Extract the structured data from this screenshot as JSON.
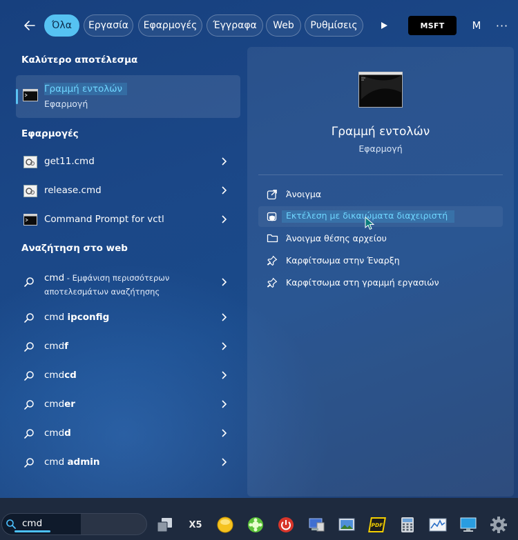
{
  "filters": {
    "tabs": [
      {
        "label": "Όλα",
        "active": true
      },
      {
        "label": "Εργασία"
      },
      {
        "label": "Εφαρμογές"
      },
      {
        "label": "Έγγραφα"
      },
      {
        "label": "Web"
      },
      {
        "label": "Ρυθμίσεις"
      }
    ],
    "msft_label": "MSFT",
    "avatar_initial": "M",
    "more_label": "···"
  },
  "best_match": {
    "section_title": "Καλύτερο αποτέλεσμα",
    "name": "Γραμμή εντολών",
    "type": "Εφαρμογή"
  },
  "apps": {
    "section_title": "Εφαρμογές",
    "items": [
      {
        "label": "get11.cmd",
        "icon": "script-file-icon"
      },
      {
        "label": "release.cmd",
        "icon": "script-file-icon"
      },
      {
        "label": "Command Prompt for vctl",
        "icon": "terminal-icon"
      }
    ]
  },
  "web": {
    "section_title": "Αναζήτηση στο web",
    "first": {
      "query": "cmd",
      "hint_line1": " - Εμφάνιση περισσότερων",
      "hint_line2": "αποτελεσμάτων αναζήτησης"
    },
    "items": [
      {
        "prefix": "cmd ",
        "bold": "ipconfig"
      },
      {
        "prefix": "cmd",
        "bold": "f"
      },
      {
        "prefix": "cmd",
        "bold": "cd"
      },
      {
        "prefix": "cmd",
        "bold": "er"
      },
      {
        "prefix": "cmd",
        "bold": "d"
      },
      {
        "prefix": "cmd ",
        "bold": "admin"
      }
    ]
  },
  "preview": {
    "name": "Γραμμή εντολών",
    "type": "Εφαρμογή",
    "actions": [
      {
        "label": "Άνοιγμα",
        "icon": "open-external-icon"
      },
      {
        "label": "Εκτέλεση με δικαιώματα διαχειριστή",
        "icon": "shield-admin-icon"
      },
      {
        "label": "Άνοιγμα θέσης αρχείου",
        "icon": "folder-icon"
      },
      {
        "label": "Καρφίτσωμα στην Έναρξη",
        "icon": "pin-icon"
      },
      {
        "label": "Καρφίτσωμα στη γραμμή εργασιών",
        "icon": "pin-icon"
      }
    ]
  },
  "taskbar": {
    "search_text": "cmd",
    "x5_label": "X5",
    "pdf_label": "PDF"
  }
}
